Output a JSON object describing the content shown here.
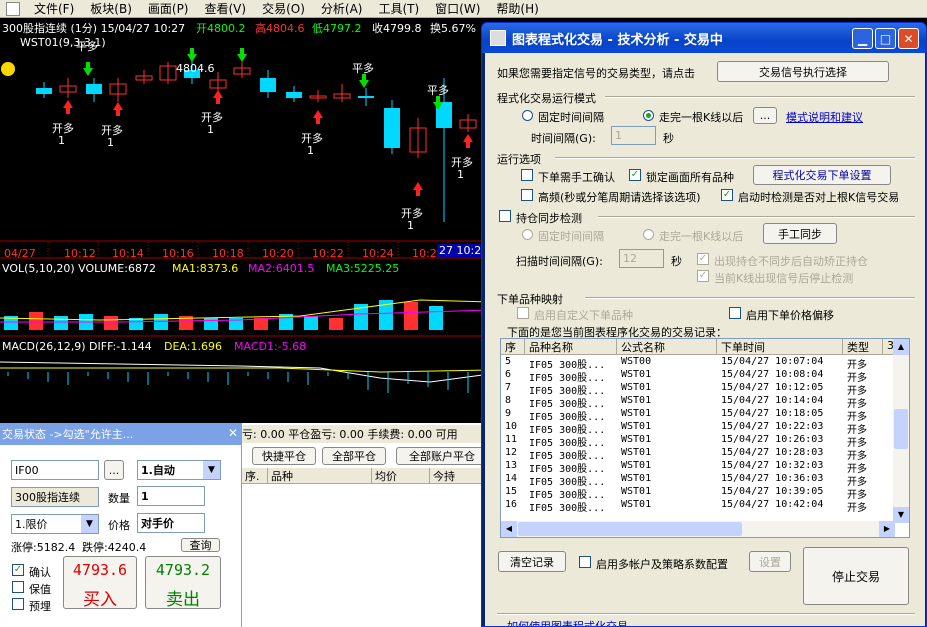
{
  "menu": [
    "文件(F)",
    "板块(B)",
    "画面(P)",
    "查看(V)",
    "交易(O)",
    "分析(A)",
    "工具(T)",
    "窗口(W)",
    "帮助(H)"
  ],
  "chart": {
    "header": "300股指连续 (1分) 15/04/27 10:27",
    "stats": [
      {
        "text": "开4800.2",
        "color": "#00ff00"
      },
      {
        "text": "高4804.6",
        "color": "#ff3030"
      },
      {
        "text": "低4797.2",
        "color": "#00ff00"
      },
      {
        "text": "收4799.8",
        "color": "#ffffff"
      },
      {
        "text": "换5.67%",
        "color": "#ffffff"
      }
    ],
    "indicator": "WST01(9,3,3,1)",
    "peak_label": "4804.6",
    "times": [
      "04/27",
      "10:12",
      "10:14",
      "10:16",
      "10:18",
      "10:20",
      "10:22",
      "10:24",
      "10:2"
    ],
    "current_time": "27 10:2",
    "signals": [
      {
        "text": "开多",
        "n": "1"
      },
      {
        "text": "开多",
        "n": "1"
      },
      {
        "text": "开多",
        "n": "1"
      },
      {
        "text": "开多",
        "n": "1"
      },
      {
        "text": "开多",
        "n": "1"
      },
      {
        "text": "开多",
        "n": "1"
      },
      {
        "text": "平多"
      },
      {
        "text": "平多"
      },
      {
        "text": "平多"
      }
    ],
    "volume_line": [
      {
        "text": "VOL(5,10,20) VOLUME:6872",
        "color": "#ffffff"
      },
      {
        "text": "MA1:8373.6",
        "color": "#ffff00"
      },
      {
        "text": "MA2:6401.5",
        "color": "#ff00ff"
      },
      {
        "text": "MA3:5225.25",
        "color": "#00ff00"
      }
    ],
    "macd_line": [
      {
        "text": "MACD(26,12,9) DIFF:-1.144",
        "color": "#ffffff"
      },
      {
        "text": "DEA:1.696",
        "color": "#ffff00"
      },
      {
        "text": "MACD1:-5.68",
        "color": "#ff00ff"
      }
    ]
  },
  "trade": {
    "title": "交易状态 ->勾选\"允许主...",
    "account": "IF00",
    "browse": "...",
    "mode": "1.自动",
    "product": "300股指连续",
    "qty_label": "数量",
    "qty": "1",
    "order_type": "1.限价",
    "price_label": "价格",
    "price": "对手价",
    "limit_up": "涨停:5182.4",
    "limit_down": "跌停:4240.4",
    "query": "查询",
    "confirm": "确认",
    "hedge": "保值",
    "preorder": "预埋",
    "buy_price": "4793.6",
    "buy": "买入",
    "sell_price": "4793.2",
    "sell": "卖出",
    "stats": "亏: 0.00    平仓盈亏: 0.00    手续费: 0.00    可用",
    "btn_quick": "快捷平仓",
    "btn_all": "全部平仓",
    "btn_all_acc": "全部账户平仓",
    "cols": [
      "序.",
      "品种",
      "均价",
      "今持"
    ]
  },
  "dialog": {
    "title": "图表程式化交易 - 技术分析 - 交易中",
    "prompt": "如果您需要指定信号的交易类型，请点击",
    "btn_signal": "交易信号执行选择",
    "sec_mode": "程式化交易运行模式",
    "opt_fixed": "固定时间间隔",
    "opt_kline": "走完一根K线以后",
    "btn_dots": "...",
    "link_mode": "模式说明和建议",
    "interval_label": "时间间隔(G):",
    "interval_value": "1",
    "sec_unit": "秒",
    "sec_run": "运行选项",
    "chk_manual": "下单需手工确认",
    "chk_lock": "锁定画面所有品种",
    "btn_order_setup": "程式化交易下单设置",
    "chk_hf": "高频(秒或分笔周期请选择该选项)",
    "chk_startup": "启动时检测是否对上根K信号交易",
    "sec_sync": "持仓同步检测",
    "sync_fixed": "固定时间间隔",
    "sync_kline": "走完一根K线以后",
    "btn_manual_sync": "手工同步",
    "scan_label": "扫描时间间隔(G):",
    "scan_value": "12",
    "sync_auto": "出现持仓不同步后自动矫正持仓",
    "sync_stop": "当前K线出现信号后停止检测",
    "sec_map": "下单品种映射",
    "chk_custom": "启用自定义下单品种",
    "chk_offset": "启用下单价格偏移",
    "records_label": "下面的是您当前图表程序化交易的交易记录：",
    "cols": [
      "序",
      "品种名称",
      "公式名称",
      "下单时间",
      "类型",
      "3"
    ],
    "rows": [
      [
        "5",
        "IF05 300股...",
        "WST00",
        "15/04/27 10:07:04",
        "开多"
      ],
      [
        "6",
        "IF05 300股...",
        "WST01",
        "15/04/27 10:08:04",
        "开多"
      ],
      [
        "7",
        "IF05 300股...",
        "WST01",
        "15/04/27 10:12:05",
        "开多"
      ],
      [
        "8",
        "IF05 300股...",
        "WST01",
        "15/04/27 10:14:04",
        "开多"
      ],
      [
        "9",
        "IF05 300股...",
        "WST01",
        "15/04/27 10:18:05",
        "开多"
      ],
      [
        "10",
        "IF05 300股...",
        "WST01",
        "15/04/27 10:22:03",
        "开多"
      ],
      [
        "11",
        "IF05 300股...",
        "WST01",
        "15/04/27 10:26:03",
        "开多"
      ],
      [
        "12",
        "IF05 300股...",
        "WST01",
        "15/04/27 10:28:03",
        "开多"
      ],
      [
        "13",
        "IF05 300股...",
        "WST01",
        "15/04/27 10:32:03",
        "开多"
      ],
      [
        "14",
        "IF05 300股...",
        "WST01",
        "15/04/27 10:36:03",
        "开多"
      ],
      [
        "15",
        "IF05 300股...",
        "WST01",
        "15/04/27 10:39:05",
        "开多"
      ],
      [
        "16",
        "IF05 300股...",
        "WST01",
        "15/04/27 10:42:04",
        "开多"
      ]
    ],
    "btn_clear": "清空记录",
    "chk_multi": "启用多帐户及策略系数配置",
    "btn_settings": "设置",
    "btn_stop": "停止交易",
    "link_help": "如何使用图表程式化交易"
  }
}
